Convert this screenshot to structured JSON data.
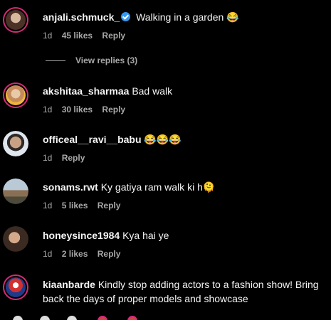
{
  "comments": [
    {
      "user": "anjali.schmuck_",
      "verified": true,
      "text": "Walking in a garden 😂",
      "time": "1d",
      "likes": "45 likes",
      "reply": "Reply"
    },
    {
      "user": "akshitaa_sharmaa",
      "text": "Bad walk",
      "time": "1d",
      "likes": "30 likes",
      "reply": "Reply"
    },
    {
      "user": "officeal__ravi__babu",
      "text": "😂😂😂",
      "time": "1d",
      "likes": "",
      "reply": "Reply"
    },
    {
      "user": "sonams.rwt",
      "text": "Ky gatiya ram walk ki h🫠",
      "time": "1d",
      "likes": "5 likes",
      "reply": "Reply"
    },
    {
      "user": "honeysince1984",
      "text": "Kya hai ye",
      "time": "1d",
      "likes": "2 likes",
      "reply": "Reply"
    },
    {
      "user": "kiaanbarde",
      "text": "Kindly stop adding actors to a fashion show! Bring back the days of proper models and showcase",
      "time": "",
      "likes": "",
      "reply": ""
    }
  ],
  "view_replies": "View replies (3)",
  "colors": {
    "background": "#000000",
    "muted": "#a8a8a8",
    "verified": "#3897f0",
    "story_ring": "#d62976"
  }
}
